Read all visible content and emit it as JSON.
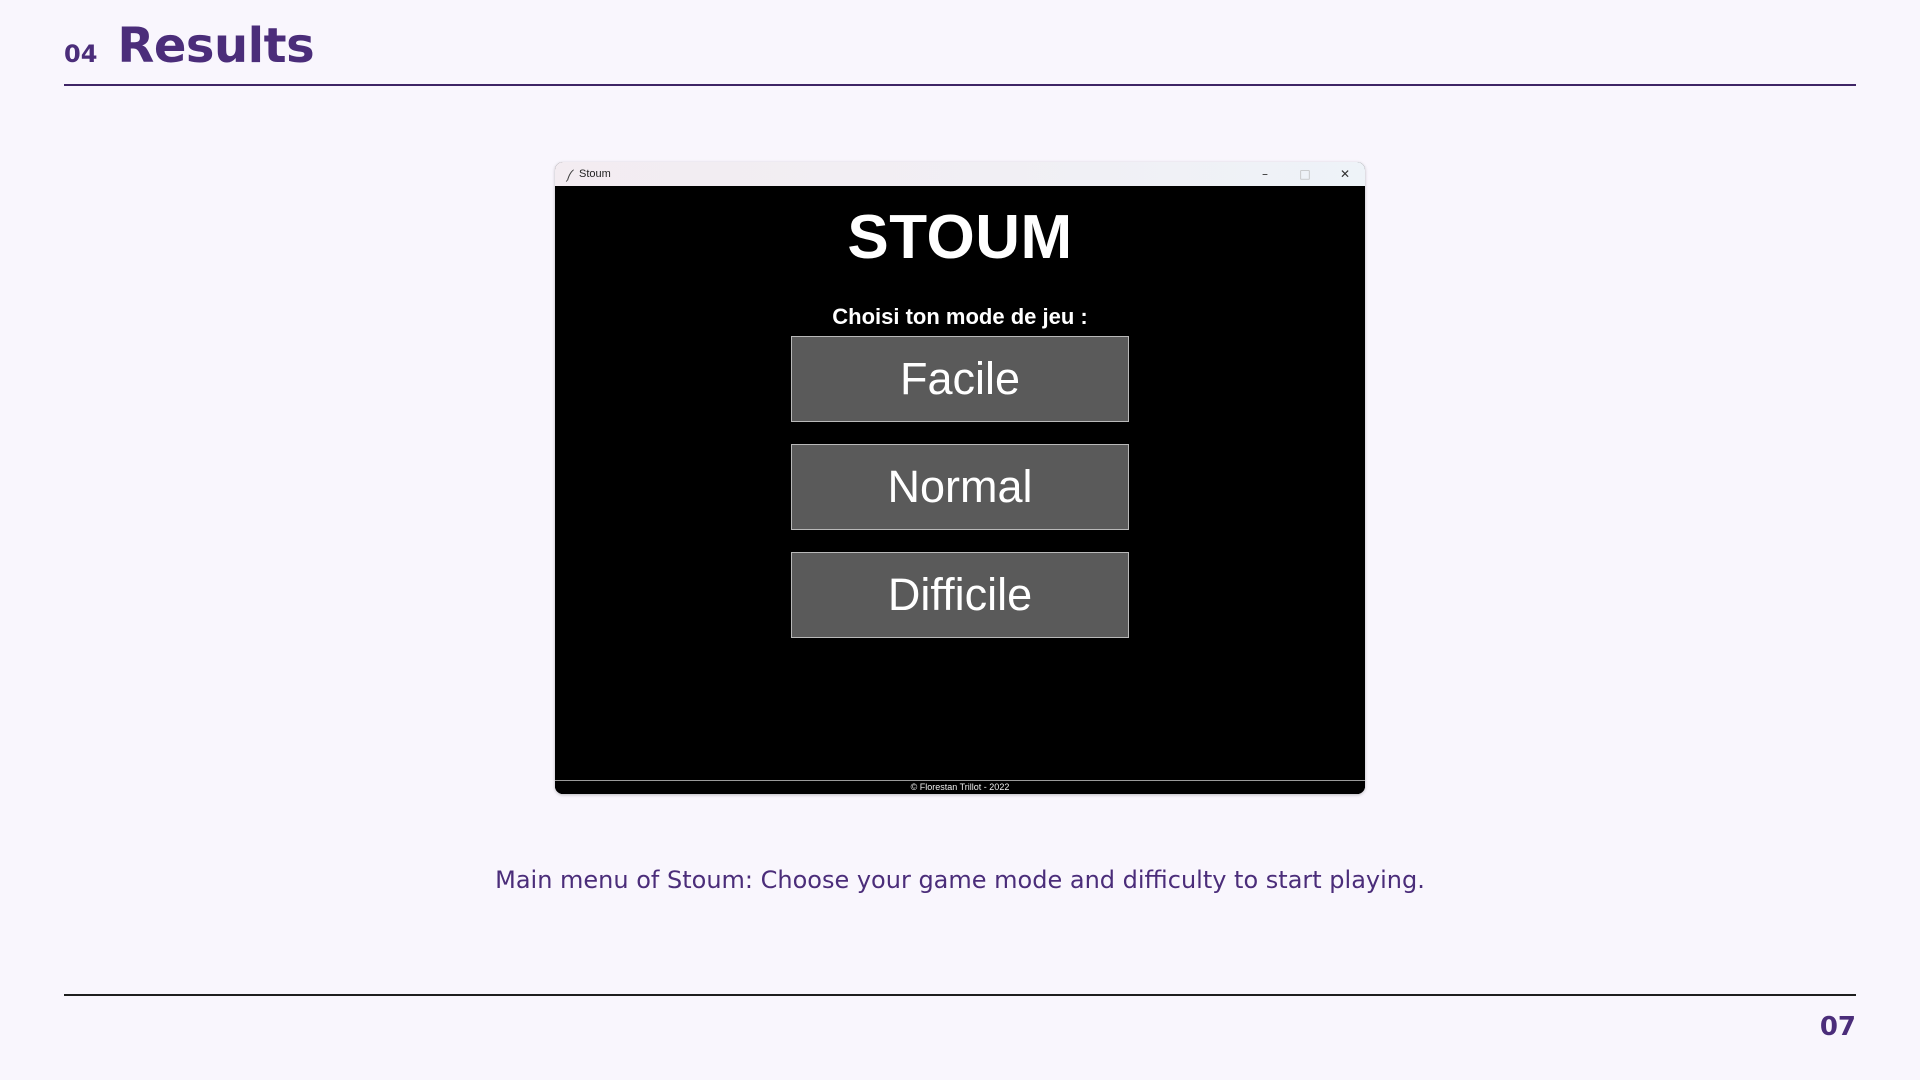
{
  "slide": {
    "section_number": "04",
    "section_title": "Results",
    "caption": "Main menu of Stoum: Choose your game mode and difficulty to start playing.",
    "page_number": "07"
  },
  "window": {
    "title": "Stoum",
    "icon": "feather-icon",
    "controls": {
      "minimize": "–",
      "maximize": "□",
      "close": "✕"
    }
  },
  "game": {
    "title": "STOUM",
    "prompt": "Choisi ton mode de jeu :",
    "modes": [
      {
        "label": "Facile"
      },
      {
        "label": "Normal"
      },
      {
        "label": "Difficile"
      }
    ],
    "footer": "© Florestan Trillot - 2022"
  },
  "colors": {
    "accent": "#4b2d7a",
    "slide_background": "#f9f6fd",
    "game_background": "#000000",
    "button_fill": "#5a5a5a",
    "button_border": "#b9b9b9"
  }
}
